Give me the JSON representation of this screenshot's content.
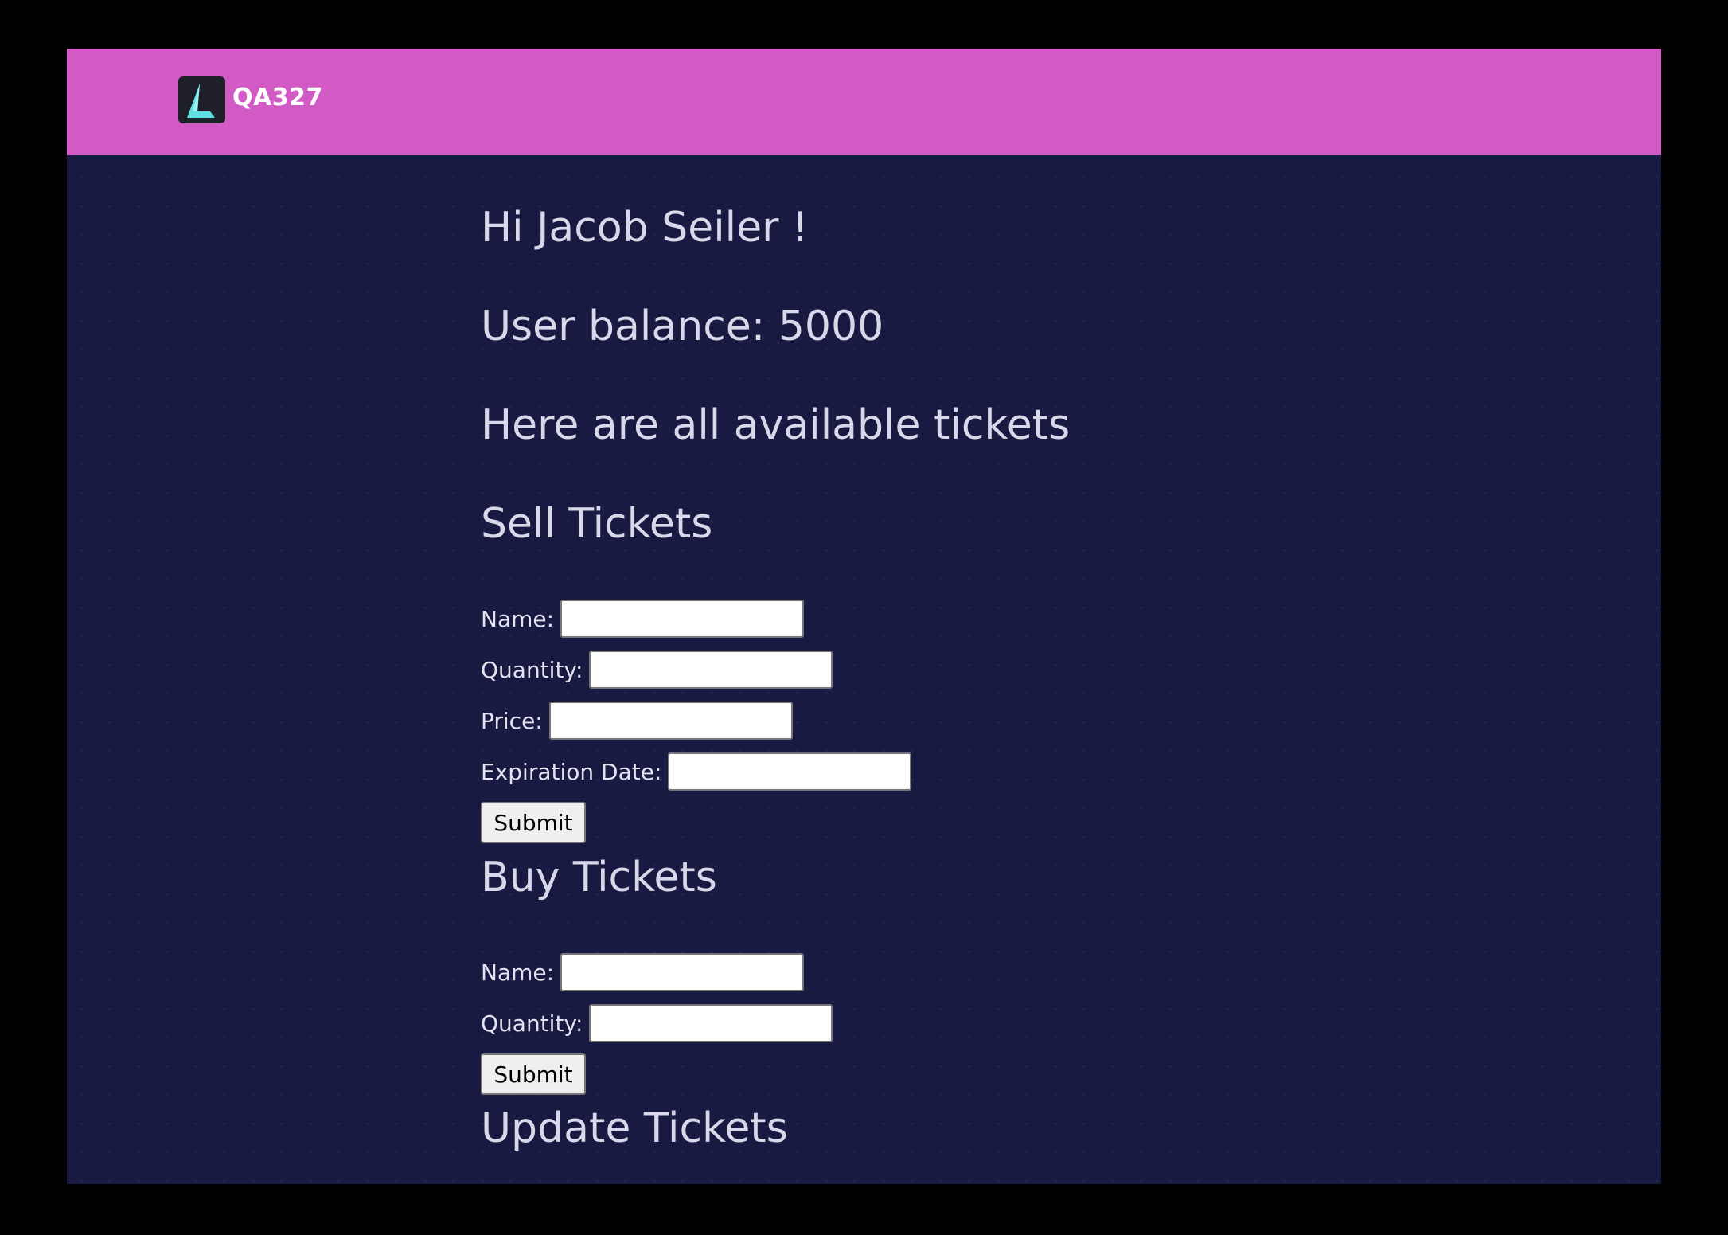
{
  "navbar": {
    "brand": "QA327",
    "background_color": "#d25ac4"
  },
  "main": {
    "greeting": "Hi Jacob Seiler !",
    "balance": "User balance: 5000",
    "tickets_heading": "Here are all available tickets",
    "sell": {
      "heading": "Sell Tickets",
      "name_label": "Name:",
      "name_value": "",
      "quantity_label": "Quantity:",
      "quantity_value": "",
      "price_label": "Price:",
      "price_value": "",
      "expiration_label": "Expiration Date:",
      "expiration_value": "",
      "submit_label": "Submit"
    },
    "buy": {
      "heading": "Buy Tickets",
      "name_label": "Name:",
      "name_value": "",
      "quantity_label": "Quantity:",
      "quantity_value": "",
      "submit_label": "Submit"
    },
    "update": {
      "heading": "Update Tickets"
    }
  },
  "colors": {
    "page_background": "#181a42",
    "text": "#d8d8ea",
    "logo_accent": "#5fe0e6"
  },
  "icons": {
    "logo": "triangle-logo-icon"
  }
}
